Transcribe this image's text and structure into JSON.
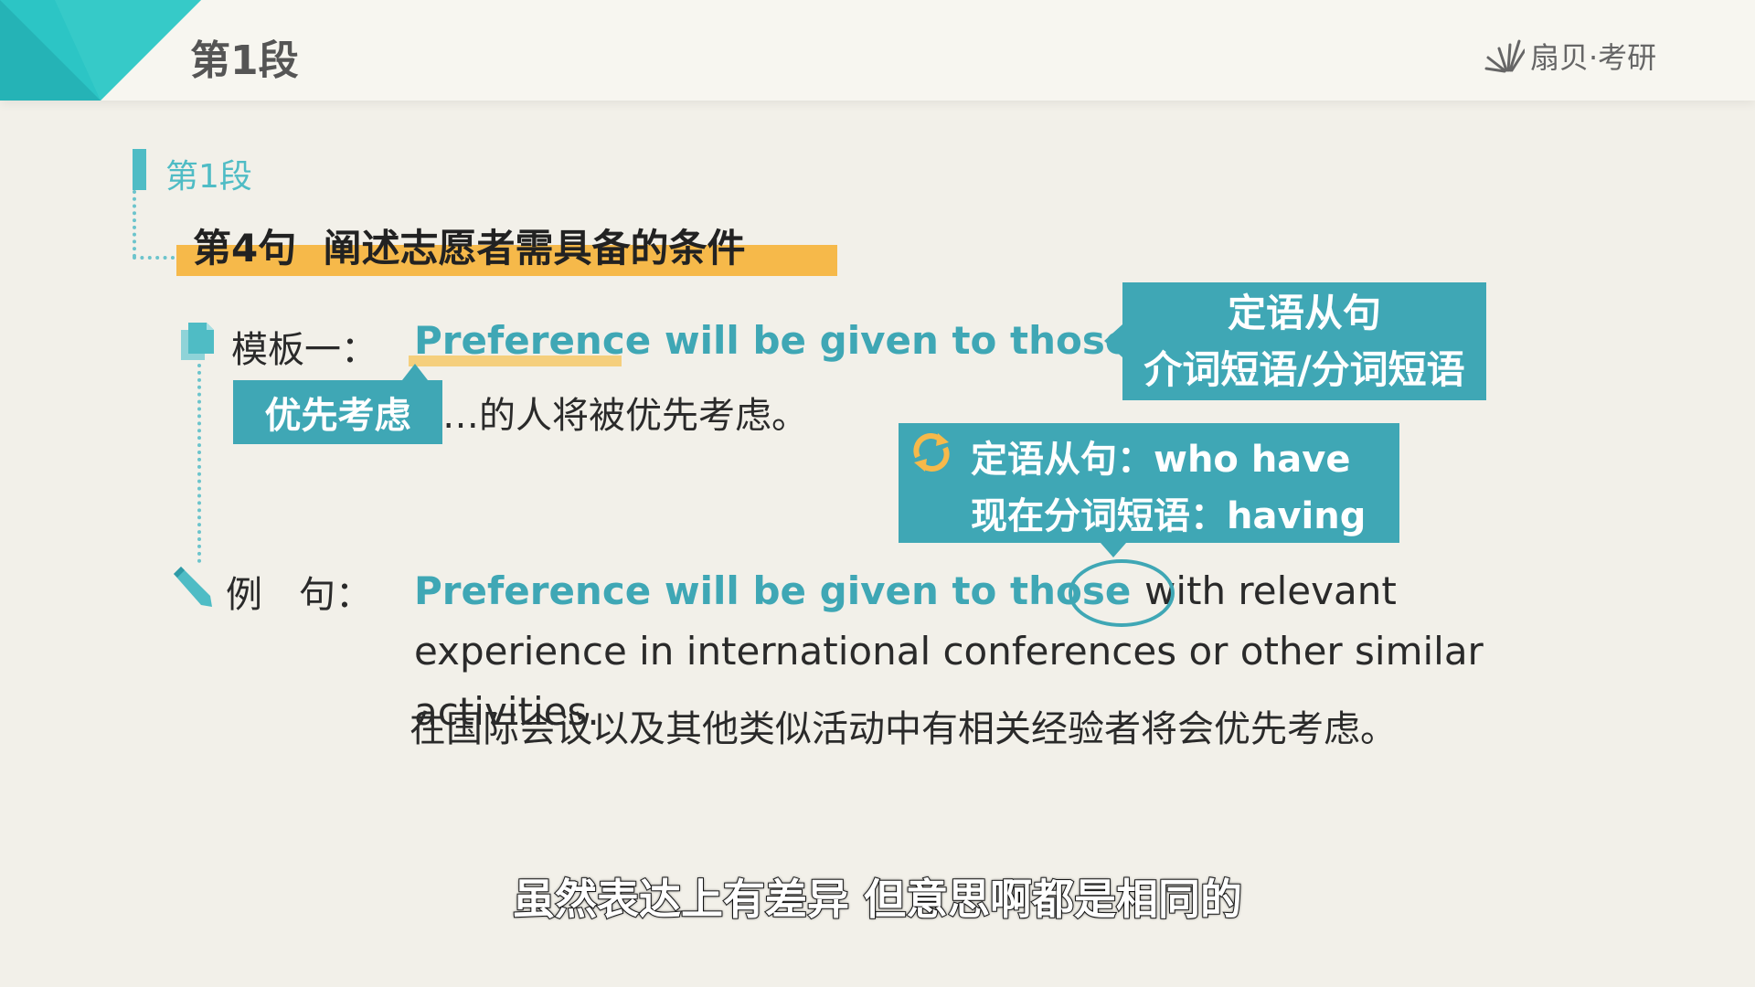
{
  "header": {
    "title": "第1段",
    "logo_text": "扇贝·考研"
  },
  "section": {
    "label": "第1段",
    "sentence_title": "第4句  阐述志愿者需具备的条件"
  },
  "template": {
    "label": "模板一：",
    "english": "Preference will be given to those ...",
    "highlight_word": "Preference",
    "tag": "优先考虑",
    "chinese": "…的人将被优先考虑。"
  },
  "callout_structures": {
    "line1": "定语从句",
    "line2": "介词短语/分词短语"
  },
  "callout_swap": {
    "line1": "定语从句：who have",
    "line2": "现在分词短语：having"
  },
  "example": {
    "label": "例　句：",
    "english_highlight": "Preference will be given to those ",
    "circled_word": "with",
    "english_rest": " relevant experience in international conferences or other similar activities.",
    "chinese": "在国际会议以及其他类似活动中有相关经验者将会优先考虑。"
  },
  "subtitle": "虽然表达上有差异  但意思啊都是相同的",
  "colors": {
    "teal": "#3fa7b5",
    "accent_teal": "#2cc5c5",
    "orange": "#f6b94a"
  }
}
